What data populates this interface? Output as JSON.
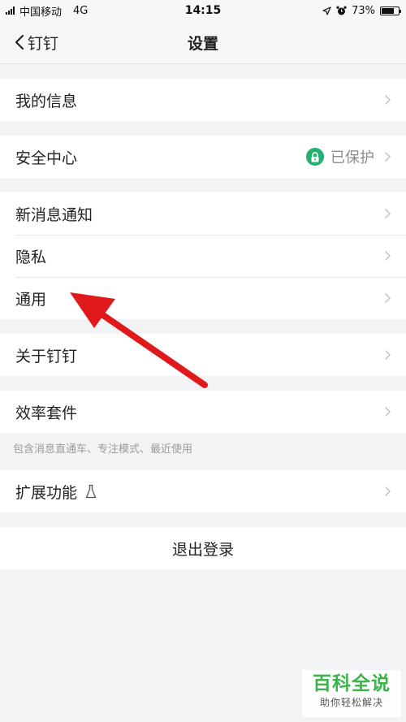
{
  "status_bar": {
    "carrier": "中国移动",
    "network": "4G",
    "time": "14:15",
    "battery": "73%",
    "battery_level": 0.73
  },
  "nav": {
    "back_label": "钉钉",
    "title": "设置"
  },
  "groups": {
    "profile": {
      "my_info": "我的信息"
    },
    "security": {
      "label": "安全中心",
      "status": "已保护"
    },
    "notifications": {
      "new_message": "新消息通知",
      "privacy": "隐私",
      "general": "通用"
    },
    "about": {
      "label": "关于钉钉"
    },
    "efficiency": {
      "label": "效率套件",
      "hint": "包含消息直通车、专注模式、最近使用"
    },
    "extensions": {
      "label": "扩展功能"
    },
    "logout": {
      "label": "退出登录"
    }
  },
  "colors": {
    "accent_green": "#23b26d",
    "arrow_red": "#e0191b",
    "watermark_green": "#3bb54a"
  },
  "watermark": {
    "title": "百科全说",
    "subtitle": "助你轻松解决"
  }
}
